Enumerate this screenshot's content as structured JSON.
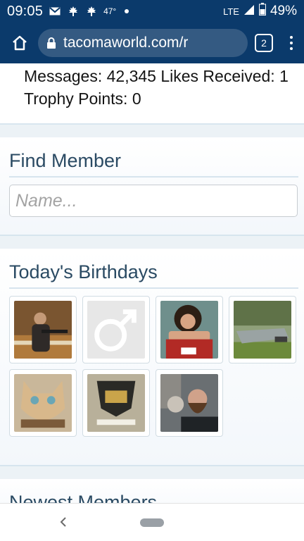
{
  "status_bar": {
    "time": "09:05",
    "icons": [
      "gmail-icon",
      "maple-leaf-icon",
      "maple-leaf-icon"
    ],
    "temperature": "47°",
    "network": "LTE",
    "battery": "49%"
  },
  "browser": {
    "url": "tacomaworld.com/r",
    "tab_count": "2"
  },
  "profile_stats": {
    "line1": "Messages: 42,345 Likes Received: 1",
    "line2": "Trophy Points: 0"
  },
  "find_member": {
    "title": "Find Member",
    "placeholder": "Name..."
  },
  "birthdays": {
    "title": "Today's Birthdays",
    "avatars": [
      {
        "name": "avatar-man-with-gun"
      },
      {
        "name": "avatar-default-male"
      },
      {
        "name": "avatar-curly-hair-man"
      },
      {
        "name": "avatar-boat"
      },
      {
        "name": "avatar-cat"
      },
      {
        "name": "avatar-badge"
      },
      {
        "name": "avatar-bearded-man-cat"
      }
    ]
  },
  "newest_members": {
    "title": "Newest Members"
  },
  "colors": {
    "status_bar": "#0b3a6b",
    "url_pill": "#345a82",
    "section_title": "#2a4a63"
  }
}
